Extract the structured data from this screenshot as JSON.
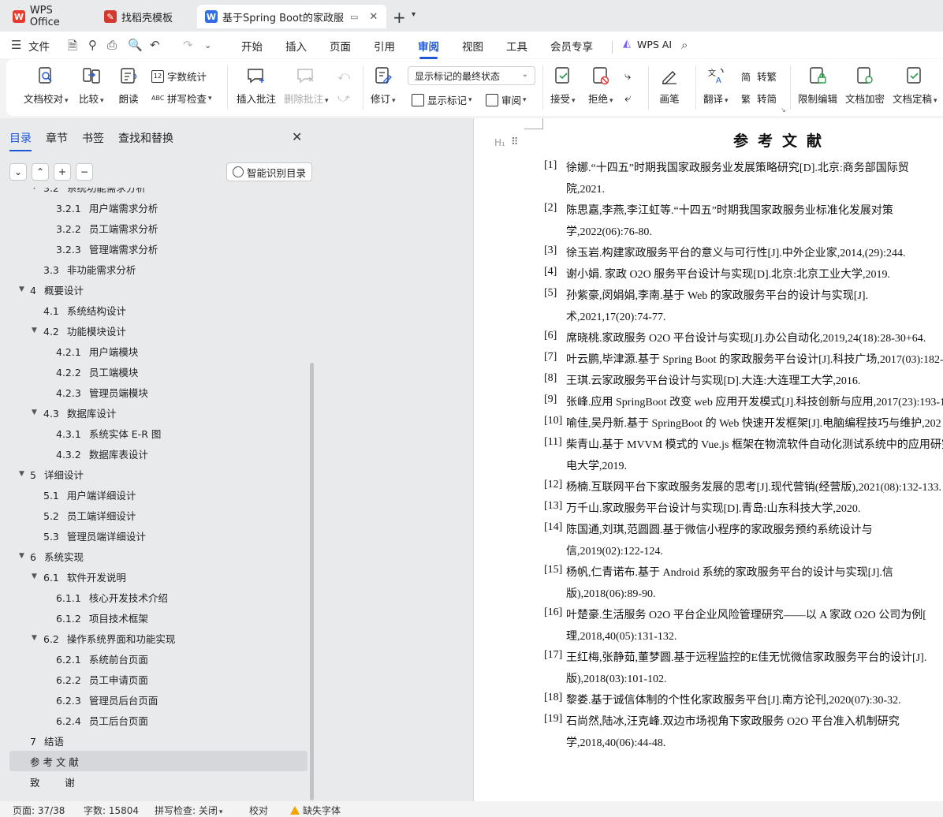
{
  "tabs": [
    {
      "label": "WPS Office",
      "icon": "wps-logo-icon",
      "color": "#e8392b"
    },
    {
      "label": "找稻壳模板",
      "icon": "docer-logo-icon",
      "color": "#d33a2f"
    },
    {
      "label": "基于Spring Boot的家政服务平",
      "icon": "writer-logo-icon",
      "color": "#2f6de6"
    }
  ],
  "menu": {
    "file": "文件",
    "items": [
      "开始",
      "插入",
      "页面",
      "引用",
      "审阅",
      "视图",
      "工具",
      "会员专享"
    ],
    "active": "审阅",
    "wps_ai": "WPS AI"
  },
  "ribbon": {
    "doc_check": "文档校对",
    "compare": "比较",
    "read": "朗读",
    "word_count": "字数统计",
    "spell_check": "拼写检查",
    "insert_comment": "插入批注",
    "delete_comment": "删除批注",
    "track": "修订",
    "display_state": "显示标记的最终状态",
    "show_marks": "显示标记",
    "review": "审阅",
    "accept": "接受",
    "reject": "拒绝",
    "pen": "画笔",
    "translate": "翻译",
    "to_traditional": "转繁",
    "to_simplified": "转简",
    "restrict_edit": "限制编辑",
    "encrypt": "文档加密",
    "finalize": "文档定稿"
  },
  "nav": {
    "tabs": [
      "目录",
      "章节",
      "书签",
      "查找和替换"
    ],
    "smart_toc": "智能识别目录",
    "toc": [
      {
        "num": "3.2",
        "label": "系统功能需求分析",
        "level": 2,
        "expanded": true
      },
      {
        "num": "3.2.1",
        "label": "用户端需求分析",
        "level": 3
      },
      {
        "num": "3.2.2",
        "label": "员工端需求分析",
        "level": 3
      },
      {
        "num": "3.2.3",
        "label": "管理端需求分析",
        "level": 3
      },
      {
        "num": "3.3",
        "label": "非功能需求分析",
        "level": 2
      },
      {
        "num": "4",
        "label": "概要设计",
        "level": 1,
        "expanded": true
      },
      {
        "num": "4.1",
        "label": "系统结构设计",
        "level": 2
      },
      {
        "num": "4.2",
        "label": "功能模块设计",
        "level": 2,
        "expanded": true
      },
      {
        "num": "4.2.1",
        "label": "用户端模块",
        "level": 3
      },
      {
        "num": "4.2.2",
        "label": "员工端模块",
        "level": 3
      },
      {
        "num": "4.2.3",
        "label": "管理员端模块",
        "level": 3
      },
      {
        "num": "4.3",
        "label": "数据库设计",
        "level": 2,
        "expanded": true
      },
      {
        "num": "4.3.1",
        "label": "系统实体 E-R 图",
        "level": 3
      },
      {
        "num": "4.3.2",
        "label": "数据库表设计",
        "level": 3
      },
      {
        "num": "5",
        "label": "详细设计",
        "level": 1,
        "expanded": true
      },
      {
        "num": "5.1",
        "label": "用户端详细设计",
        "level": 2
      },
      {
        "num": "5.2",
        "label": "员工端详细设计",
        "level": 2
      },
      {
        "num": "5.3",
        "label": "管理员端详细设计",
        "level": 2
      },
      {
        "num": "6",
        "label": "系统实现",
        "level": 1,
        "expanded": true
      },
      {
        "num": "6.1",
        "label": "软件开发说明",
        "level": 2,
        "expanded": true
      },
      {
        "num": "6.1.1",
        "label": "核心开发技术介绍",
        "level": 3
      },
      {
        "num": "6.1.2",
        "label": "项目技术框架",
        "level": 3
      },
      {
        "num": "6.2",
        "label": "操作系统界面和功能实现",
        "level": 2,
        "expanded": true
      },
      {
        "num": "6.2.1",
        "label": "系统前台页面",
        "level": 3
      },
      {
        "num": "6.2.2",
        "label": "员工申请页面",
        "level": 3
      },
      {
        "num": "6.2.3",
        "label": "管理员后台页面",
        "level": 3
      },
      {
        "num": "6.2.4",
        "label": "员工后台页面",
        "level": 3
      },
      {
        "num": "7",
        "label": "结语",
        "level": 1
      },
      {
        "num": "",
        "label": "参 考 文 献",
        "level": 1,
        "selected": true
      },
      {
        "num": "",
        "label": "致        谢",
        "level": 1
      }
    ]
  },
  "document": {
    "heading_marker": "H₁",
    "title": "参考文献",
    "refs": [
      {
        "idx": "[1]",
        "lines": [
          "徐娜.“十四五”时期我国家政服务业发展策略研究[D].北京:商务部国际贸",
          "院,2021."
        ]
      },
      {
        "idx": "[2]",
        "lines": [
          "陈思嘉,李燕,李江虹等.“十四五”时期我国家政服务业标准化发展对策",
          "学,2022(06):76-80."
        ]
      },
      {
        "idx": "[3]",
        "lines": [
          "徐玉岩.构建家政服务平台的意义与可行性[J].中外企业家,2014,(29):244."
        ]
      },
      {
        "idx": "[4]",
        "lines": [
          "谢小娟. 家政 O2O 服务平台设计与实现[D].北京:北京工业大学,2019."
        ]
      },
      {
        "idx": "[5]",
        "lines": [
          "孙紫豪,闵娟娟,李南.基于 Web 的家政服务平台的设计与实现[J].",
          "术,2021,17(20):74-77."
        ]
      },
      {
        "idx": "[6]",
        "lines": [
          "席晓桃.家政服务 O2O 平台设计与实现[J].办公自动化,2019,24(18):28-30+64."
        ]
      },
      {
        "idx": "[7]",
        "lines": [
          "叶云鹏,毕津源.基于 Spring Boot 的家政服务平台设计[J].科技广场,2017(03):182-"
        ]
      },
      {
        "idx": "[8]",
        "lines": [
          "王琪.云家政服务平台设计与实现[D].大连:大连理工大学,2016."
        ]
      },
      {
        "idx": "[9]",
        "lines": [
          "张峰.应用 SpringBoot 改变 web 应用开发模式[J].科技创新与应用,2017(23):193-1"
        ]
      },
      {
        "idx": "[10]",
        "lines": [
          "喻佳,吴丹新.基于 SpringBoot 的 Web 快速开发框架[J].电脑编程技巧与维护,202"
        ]
      },
      {
        "idx": "[11]",
        "lines": [
          "柴青山.基于 MVVM 模式的 Vue.js 框架在物流软件自动化测试系统中的应用研究",
          "电大学,2019."
        ]
      },
      {
        "idx": "[12]",
        "lines": [
          "杨楠.互联网平台下家政服务发展的思考[J].现代营销(经营版),2021(08):132-133."
        ]
      },
      {
        "idx": "[13]",
        "lines": [
          "万千山.家政服务平台设计与实现[D].青岛:山东科技大学,2020."
        ]
      },
      {
        "idx": "[14]",
        "lines": [
          "陈国通,刘琪,范圆圆.基于微信小程序的家政服务预约系统设计与",
          "信,2019(02):122-124."
        ]
      },
      {
        "idx": "[15]",
        "lines": [
          "杨帆,仁青诺布.基于 Android 系统的家政服务平台的设计与实现[J].信",
          "版),2018(06):89-90."
        ]
      },
      {
        "idx": "[16]",
        "lines": [
          "叶楚豪.生活服务 O2O 平台企业风险管理研究——以 A 家政 O2O 公司为例[",
          "理,2018,40(05):131-132."
        ]
      },
      {
        "idx": "[17]",
        "lines": [
          "王红梅,张静茹,董梦圆.基于远程监控的E佳无忧微信家政服务平台的设计[J].",
          "版),2018(03):101-102."
        ]
      },
      {
        "idx": "[18]",
        "lines": [
          "黎娄.基于诚信体制的个性化家政服务平台[J].南方论刊,2020(07):30-32."
        ]
      },
      {
        "idx": "[19]",
        "lines": [
          "石尚然,陆冰,汪克峰.双边市场视角下家政服务 O2O 平台准入机制研究",
          "学,2018,40(06):44-48."
        ]
      }
    ]
  },
  "status": {
    "page": "页面: 37/38",
    "words": "字数: 15804",
    "spell": "拼写检查: 关闭",
    "proof": "校对",
    "missing_font": "缺失字体"
  },
  "colors": {
    "accent": "#1e56d8",
    "warning": "#f0a500"
  }
}
